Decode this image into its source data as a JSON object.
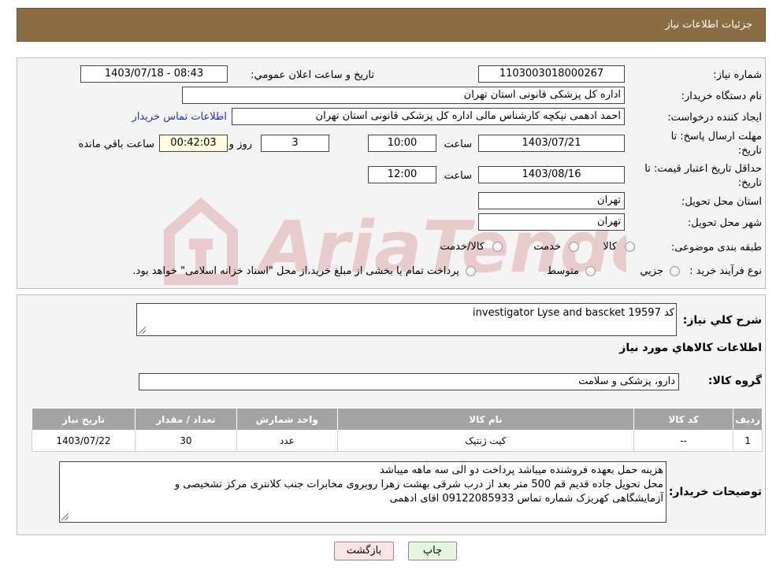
{
  "header": {
    "title": "جزئیات اطلاعات نیاز"
  },
  "form": {
    "need_number_label": "شماره نیاز:",
    "need_number": "1103003018000267",
    "announce_label": "تاریخ و ساعت اعلان عمومي:",
    "announce_value": "1403/07/18 - 08:43",
    "buyer_org_label": "نام دستگاه خريدار:",
    "buyer_org": "اداره کل پزشکی قانونی استان تهران",
    "requester_label": "ايجاد کننده درخواست:",
    "requester": "احمد ادهمی نیکچه کارشناس مالی اداره کل پزشکی قانونی استان تهران",
    "contact_link": "اطلاعات تماس خريدار",
    "deadline_label_1": "مهلت ارسال پاسخ: تا",
    "deadline_label_2": "تاريخ:",
    "deadline_date": "1403/07/21",
    "time_label": "ساعت",
    "deadline_time": "10:00",
    "days_value": "3",
    "days_label": "روز و",
    "remaining_time": "00:42:03",
    "remaining_label": "ساعت باقي مانده",
    "price_valid_label_1": "حداقل تاريخ اعتبار قيمت: تا",
    "price_valid_label_2": "تاريخ:",
    "price_valid_date": "1403/08/16",
    "price_valid_time": "12:00",
    "province_label": "استان محل تحويل:",
    "province": "تهران",
    "city_label": "شهر محل تحويل:",
    "city": "تهران",
    "category_label": "طبقه بندی موضوعی:",
    "category_options": [
      "کالا",
      "خدمت",
      "کالا/خدمت"
    ],
    "process_label": "نوع فرآيند خريد :",
    "process_options": [
      "جزيي",
      "متوسط"
    ],
    "process_note": "پرداخت تمام يا بخشی از مبلغ خريد،از محل \"اسناد خزانه اسلامی\" خواهد بود."
  },
  "description": {
    "label": "شرح کلي نياز:",
    "value": "investigator Lyse and bascket کد 19597",
    "goods_info_label": "اطلاعات کالاهاي مورد نياز",
    "group_label": "گروه کالا:",
    "group_value": "دارو، پزشکی و سلامت"
  },
  "table": {
    "headers": [
      "رديف",
      "کد کالا",
      "نام کالا",
      "واحد شمارش",
      "تعداد / مقدار",
      "تاريخ نياز"
    ],
    "rows": [
      {
        "index": "1",
        "code": "--",
        "name": "کیت ژنتیک",
        "unit": "عدد",
        "qty": "30",
        "date": "1403/07/22"
      }
    ]
  },
  "buyer_notes": {
    "label": "توضيحات خريدار:",
    "line1": "هزینه حمل بعهده فروشنده میباشد پرداخت دو الی سه ماهه میباشد",
    "line2": "محل تحویل جاده قدیم قم 500 متر بعد از درب شرقی بهشت زهرا روبروی مخابرات جنب کلانتری مرکز تشخیصی و",
    "line3": "آزمایشگاهی کهریزک شماره تماس 09122085933 اقای ادهمی"
  },
  "buttons": {
    "print": "چاپ",
    "back": "بازگشت"
  },
  "colors": {
    "header_bg": "#8b6d43",
    "back_btn_bg": "#ffe4e1",
    "print_btn_bg": "#e6f5e0",
    "link": "#1f2fd0"
  }
}
